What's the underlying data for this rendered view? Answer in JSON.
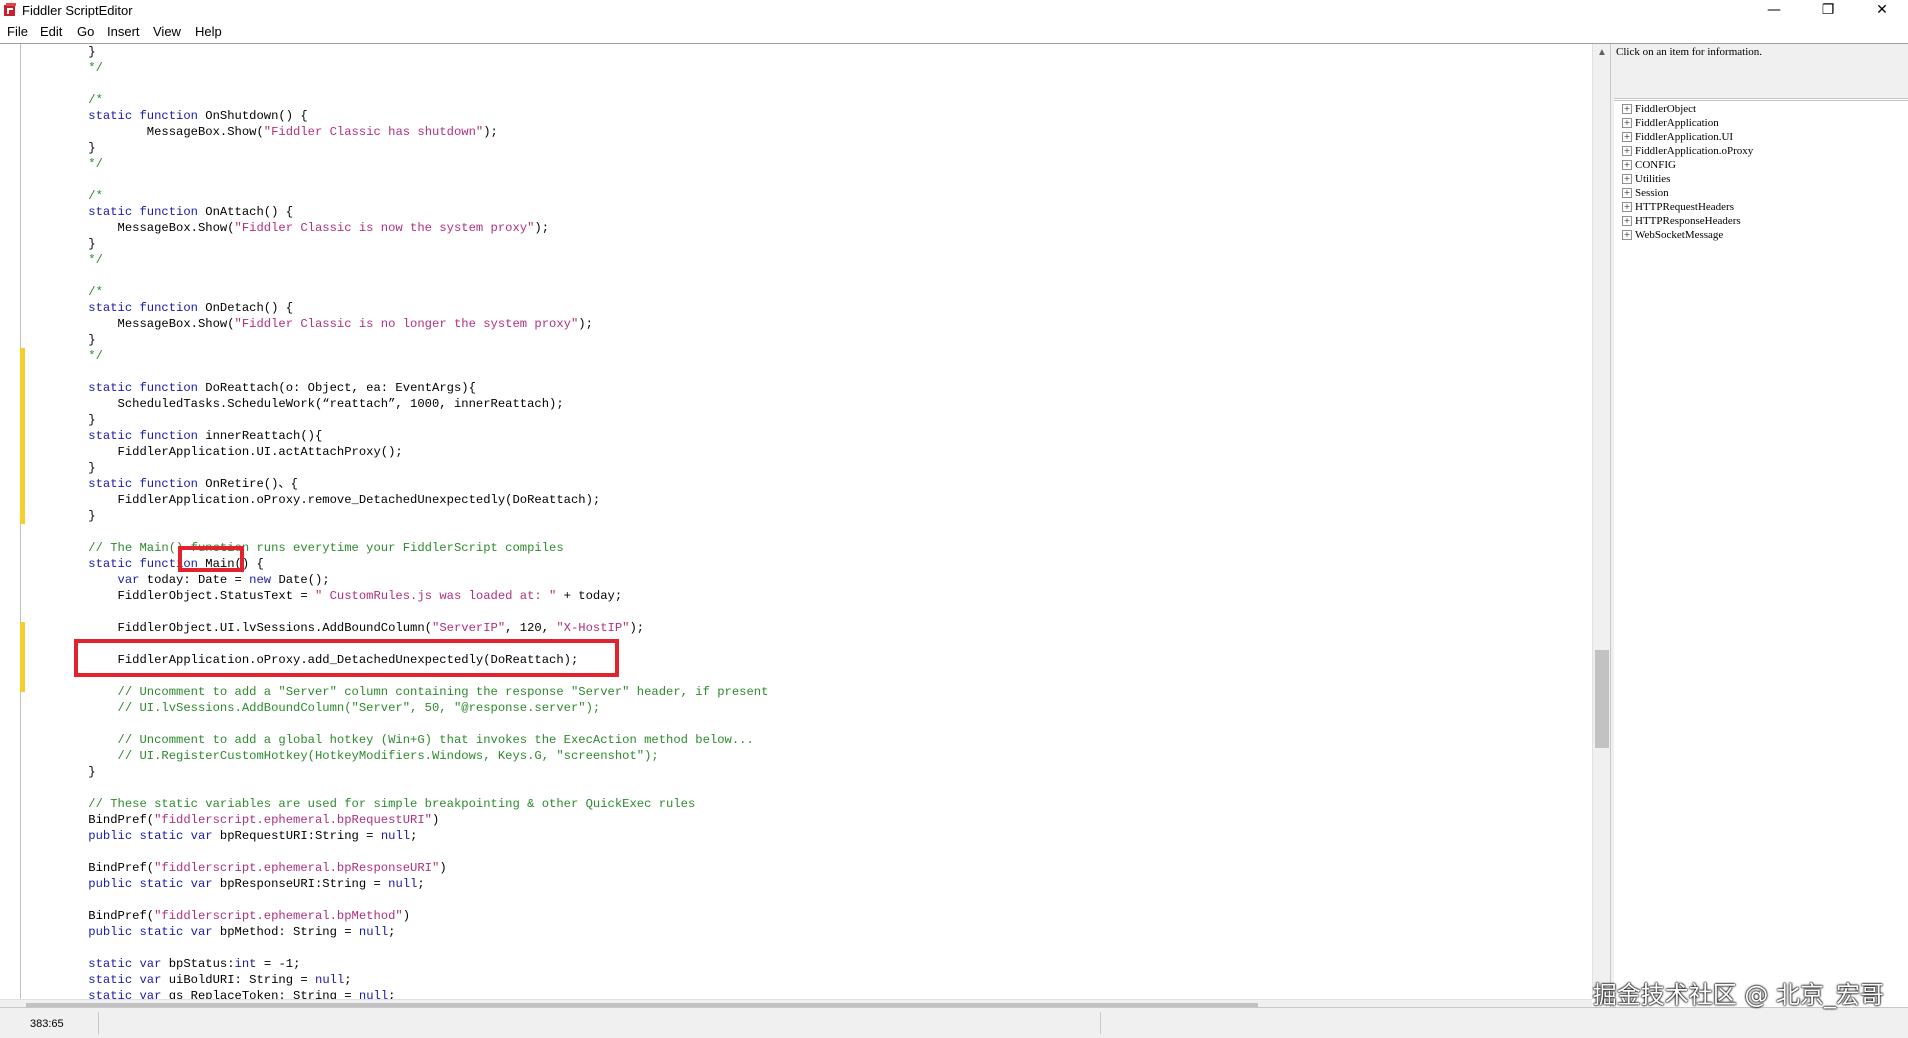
{
  "window": {
    "title": "Fiddler ScriptEditor",
    "minimize_glyph": "—",
    "restore_glyph": "❐",
    "close_glyph": "✕"
  },
  "menu": [
    "File",
    "Edit",
    "Go",
    "Insert",
    "View",
    "Help"
  ],
  "editor": {
    "lines": [
      [
        [
          "pl",
          "    }"
        ]
      ],
      [
        [
          "cm",
          "    */"
        ]
      ],
      [
        [
          "pl",
          ""
        ]
      ],
      [
        [
          "cm",
          "    /*"
        ]
      ],
      [
        [
          "kw",
          "    static function "
        ],
        [
          "pl",
          "OnShutdown() {"
        ]
      ],
      [
        [
          "pl",
          "            MessageBox.Show("
        ],
        [
          "st",
          "\"Fiddler Classic has shutdown\""
        ],
        [
          "pl",
          ");"
        ]
      ],
      [
        [
          "pl",
          "    }"
        ]
      ],
      [
        [
          "cm",
          "    */"
        ]
      ],
      [
        [
          "pl",
          ""
        ]
      ],
      [
        [
          "cm",
          "    /*"
        ]
      ],
      [
        [
          "kw",
          "    static function "
        ],
        [
          "pl",
          "OnAttach() {"
        ]
      ],
      [
        [
          "pl",
          "        MessageBox.Show("
        ],
        [
          "st",
          "\"Fiddler Classic is now the system proxy\""
        ],
        [
          "pl",
          ");"
        ]
      ],
      [
        [
          "pl",
          "    }"
        ]
      ],
      [
        [
          "cm",
          "    */"
        ]
      ],
      [
        [
          "pl",
          ""
        ]
      ],
      [
        [
          "cm",
          "    /*"
        ]
      ],
      [
        [
          "kw",
          "    static function "
        ],
        [
          "pl",
          "OnDetach() {"
        ]
      ],
      [
        [
          "pl",
          "        MessageBox.Show("
        ],
        [
          "st",
          "\"Fiddler Classic is no longer the system proxy\""
        ],
        [
          "pl",
          ");"
        ]
      ],
      [
        [
          "pl",
          "    }"
        ]
      ],
      [
        [
          "cm",
          "    */"
        ]
      ],
      [
        [
          "pl",
          ""
        ]
      ],
      [
        [
          "kw",
          "    static function "
        ],
        [
          "pl",
          "DoReattach(o: Object, ea: EventArgs){"
        ]
      ],
      [
        [
          "pl",
          "        ScheduledTasks.ScheduleWork(“reattach”, 1000, innerReattach);"
        ]
      ],
      [
        [
          "pl",
          "    }"
        ]
      ],
      [
        [
          "kw",
          "    static function "
        ],
        [
          "pl",
          "innerReattach(){"
        ]
      ],
      [
        [
          "pl",
          "        FiddlerApplication.UI.actAttachProxy();"
        ]
      ],
      [
        [
          "pl",
          "    }"
        ]
      ],
      [
        [
          "kw",
          "    static function "
        ],
        [
          "pl",
          "OnRetire()、{"
        ]
      ],
      [
        [
          "pl",
          "        FiddlerApplication.oProxy.remove_DetachedUnexpectedly(DoReattach);"
        ]
      ],
      [
        [
          "pl",
          "    }"
        ]
      ],
      [
        [
          "pl",
          ""
        ]
      ],
      [
        [
          "cm",
          "    // The Main() function runs everytime your FiddlerScript compiles"
        ]
      ],
      [
        [
          "kw",
          "    static function "
        ],
        [
          "pl",
          "Main() {"
        ]
      ],
      [
        [
          "kw",
          "        var "
        ],
        [
          "pl",
          "today: Date = "
        ],
        [
          "kw",
          "new "
        ],
        [
          "pl",
          "Date();"
        ]
      ],
      [
        [
          "pl",
          "        FiddlerObject.StatusText = "
        ],
        [
          "st",
          "\" CustomRules.js was loaded at: \""
        ],
        [
          "pl",
          " + today;"
        ]
      ],
      [
        [
          "pl",
          ""
        ]
      ],
      [
        [
          "pl",
          "        FiddlerObject.UI.lvSessions.AddBoundColumn("
        ],
        [
          "st",
          "\"ServerIP\""
        ],
        [
          "pl",
          ", 120, "
        ],
        [
          "st",
          "\"X-HostIP\""
        ],
        [
          "pl",
          ");"
        ]
      ],
      [
        [
          "pl",
          ""
        ]
      ],
      [
        [
          "pl",
          "        FiddlerApplication.oProxy.add_DetachedUnexpectedly(DoReattach);"
        ]
      ],
      [
        [
          "pl",
          ""
        ]
      ],
      [
        [
          "cm",
          "        // Uncomment to add a \"Server\" column containing the response \"Server\" header, if present"
        ]
      ],
      [
        [
          "cm",
          "        // UI.lvSessions.AddBoundColumn(\"Server\", 50, \"@response.server\");"
        ]
      ],
      [
        [
          "pl",
          ""
        ]
      ],
      [
        [
          "cm",
          "        // Uncomment to add a global hotkey (Win+G) that invokes the ExecAction method below..."
        ]
      ],
      [
        [
          "cm",
          "        // UI.RegisterCustomHotkey(HotkeyModifiers.Windows, Keys.G, \"screenshot\");"
        ]
      ],
      [
        [
          "pl",
          "    }"
        ]
      ],
      [
        [
          "pl",
          ""
        ]
      ],
      [
        [
          "cm",
          "    // These static variables are used for simple breakpointing & other QuickExec rules"
        ]
      ],
      [
        [
          "pl",
          "    BindPref("
        ],
        [
          "st",
          "\"fiddlerscript.ephemeral.bpRequestURI\""
        ],
        [
          "pl",
          ")"
        ]
      ],
      [
        [
          "kw",
          "    public static var "
        ],
        [
          "pl",
          "bpRequestURI:String = "
        ],
        [
          "kw",
          "null"
        ],
        [
          "pl",
          ";"
        ]
      ],
      [
        [
          "pl",
          ""
        ]
      ],
      [
        [
          "pl",
          "    BindPref("
        ],
        [
          "st",
          "\"fiddlerscript.ephemeral.bpResponseURI\""
        ],
        [
          "pl",
          ")"
        ]
      ],
      [
        [
          "kw",
          "    public static var "
        ],
        [
          "pl",
          "bpResponseURI:String = "
        ],
        [
          "kw",
          "null"
        ],
        [
          "pl",
          ";"
        ]
      ],
      [
        [
          "pl",
          ""
        ]
      ],
      [
        [
          "pl",
          "    BindPref("
        ],
        [
          "st",
          "\"fiddlerscript.ephemeral.bpMethod\""
        ],
        [
          "pl",
          ")"
        ]
      ],
      [
        [
          "kw",
          "    public static var "
        ],
        [
          "pl",
          "bpMethod: String = "
        ],
        [
          "kw",
          "null"
        ],
        [
          "pl",
          ";"
        ]
      ],
      [
        [
          "pl",
          ""
        ]
      ],
      [
        [
          "kw",
          "    static var "
        ],
        [
          "pl",
          "bpStatus:"
        ],
        [
          "kw",
          "int"
        ],
        [
          "pl",
          " = -1;"
        ]
      ],
      [
        [
          "kw",
          "    static var "
        ],
        [
          "pl",
          "uiBoldURI: String = "
        ],
        [
          "kw",
          "null"
        ],
        [
          "pl",
          ";"
        ]
      ],
      [
        [
          "kw",
          "    static var "
        ],
        [
          "pl",
          "gs_ReplaceToken: String = "
        ],
        [
          "kw",
          "null"
        ],
        [
          "pl",
          ";"
        ]
      ]
    ]
  },
  "info_panel": {
    "text": "Click on an item for information."
  },
  "object_tree": [
    "FiddlerObject",
    "FiddlerApplication",
    "FiddlerApplication.UI",
    "FiddlerApplication.oProxy",
    "CONFIG",
    "Utilities",
    "Session",
    "HTTPRequestHeaders",
    "HTTPResponseHeaders",
    "WebSocketMessage"
  ],
  "tree_expander_glyph": "+",
  "status_bar": {
    "position": "383:65"
  },
  "watermark": "掘金技术社区 @ 北京_宏哥",
  "scroll_glyphs": {
    "up": "▲",
    "left": "‹"
  },
  "colors": {
    "keyword": "#1a1aaa",
    "comment": "#2d8a2d",
    "string": "#b0307e",
    "annotation_box": "#e0232f",
    "change_marker": "#f5cf2e"
  }
}
